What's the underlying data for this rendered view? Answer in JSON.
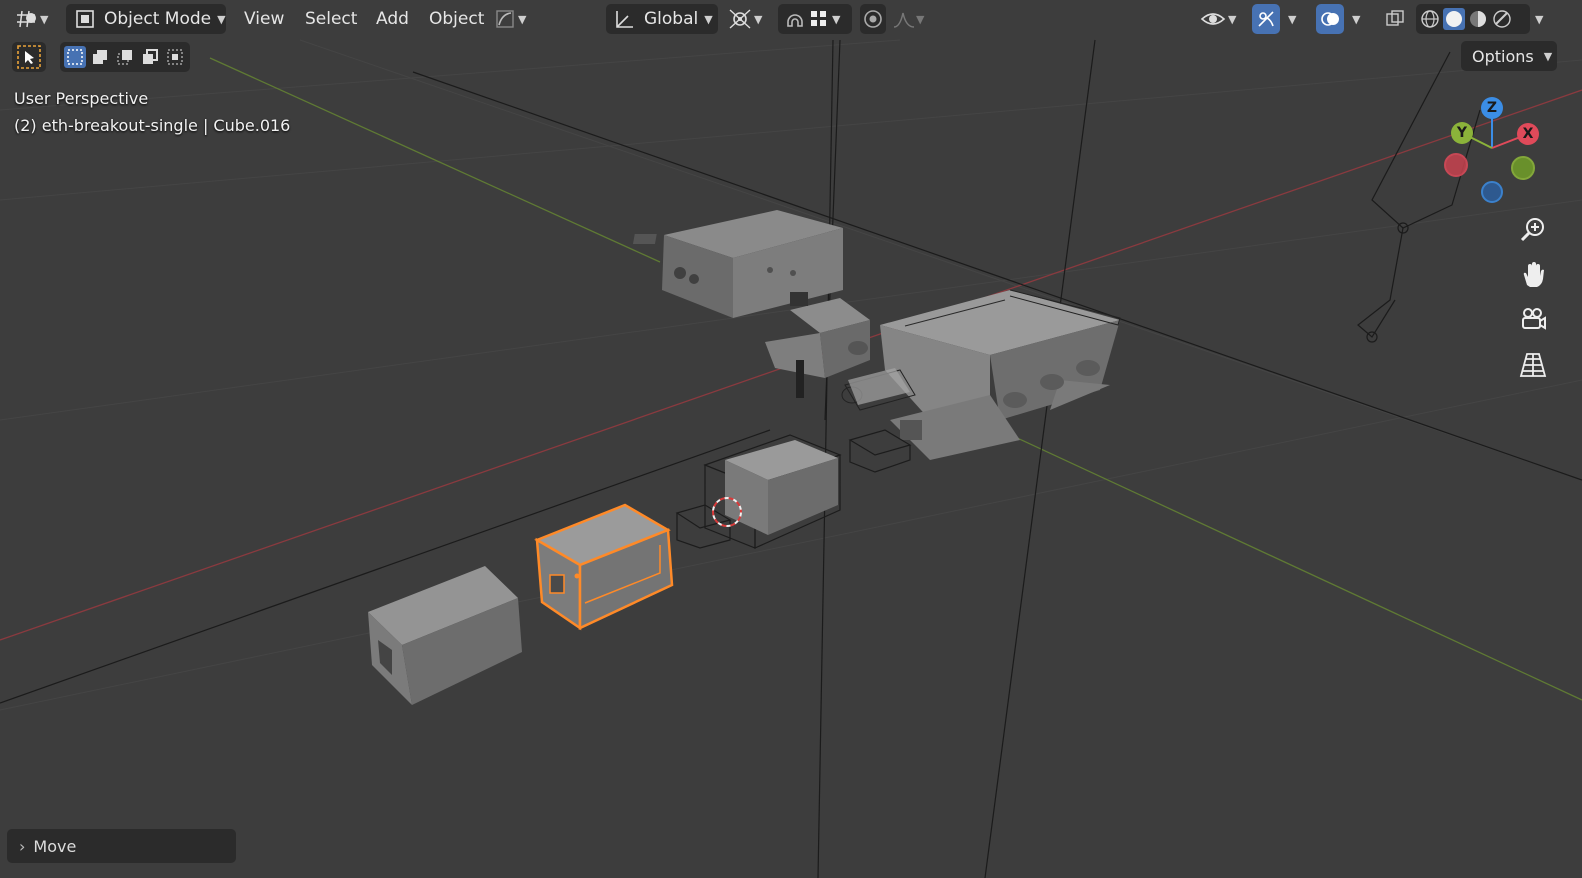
{
  "header": {
    "mode_label": "Object Mode",
    "menus": [
      "View",
      "Select",
      "Add",
      "Object"
    ],
    "orientation_label": "Global",
    "editor_icon": "editor-type-icon",
    "icons": [
      "transform-pivot-icon",
      "snap-icon",
      "snap-grid-icon",
      "proportional-edit-icon",
      "falloff-icon",
      "visibility-icon",
      "gizmo-icon",
      "overlay-icon",
      "xray-icon",
      "shading-wireframe-icon",
      "shading-solid-icon",
      "shading-material-icon",
      "shading-rendered-icon"
    ]
  },
  "toolbar": {
    "select_tool": "select-box-tool-icon",
    "modes": [
      "select-new-icon",
      "select-extend-icon",
      "select-subtract-icon",
      "select-invert-icon",
      "select-intersect-icon"
    ],
    "options_label": "Options"
  },
  "viewport": {
    "perspective_label": "User Perspective",
    "object_info": "(2) eth-breakout-single | Cube.016"
  },
  "gizmo": {
    "x_label": "X",
    "y_label": "Y",
    "z_label": "Z",
    "colors": {
      "x": "#e04a5a",
      "y": "#8bb33a",
      "z": "#3b8de5"
    }
  },
  "nav_buttons": [
    "zoom-icon",
    "pan-hand-icon",
    "camera-view-icon",
    "perspective-grid-icon"
  ],
  "last_operator": {
    "label": "Move"
  },
  "colors": {
    "selected_outline": "#ff8a28",
    "active_blue": "#4772b3",
    "background": "#3d3d3d"
  }
}
